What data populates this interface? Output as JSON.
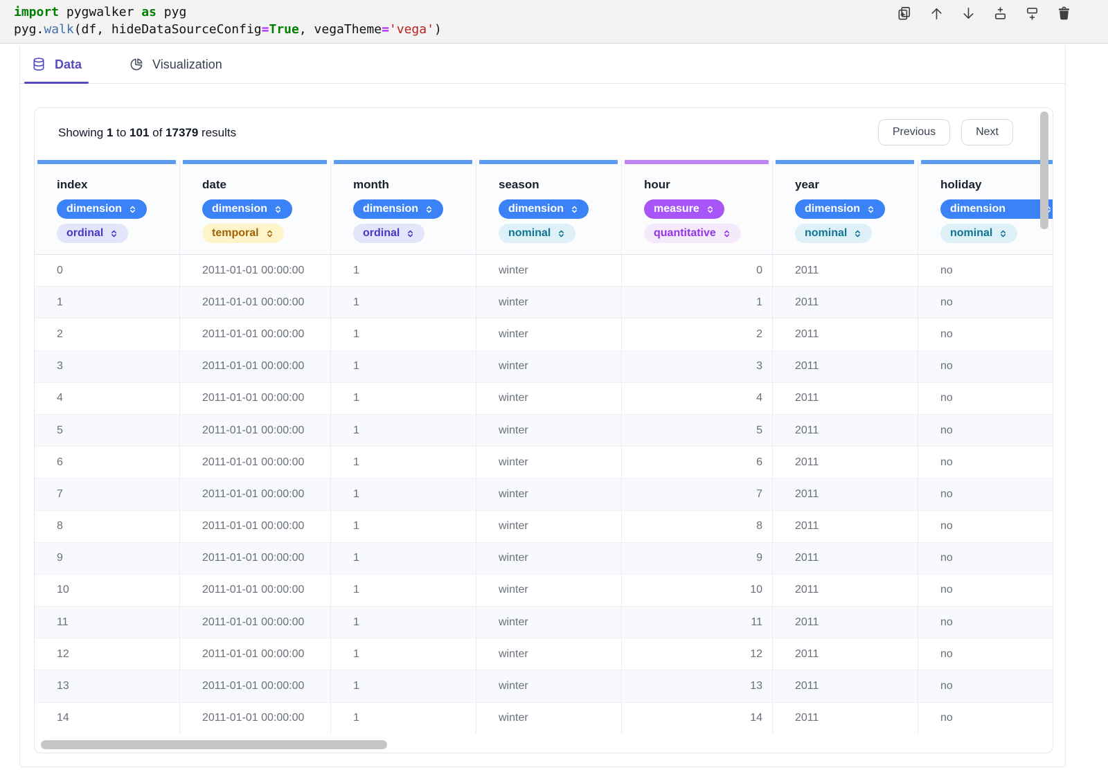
{
  "code_cell": {
    "lines": [
      {
        "tokens": [
          {
            "text": "import",
            "style": "keyword"
          },
          {
            "text": " pygwalker ",
            "style": "plain"
          },
          {
            "text": "as",
            "style": "keyword"
          },
          {
            "text": " pyg",
            "style": "plain"
          }
        ]
      },
      {
        "tokens": [
          {
            "text": "pyg.",
            "style": "plain"
          },
          {
            "text": "walk",
            "style": "function"
          },
          {
            "text": "(df, hideDataSourceConfig",
            "style": "plain"
          },
          {
            "text": "=",
            "style": "operator"
          },
          {
            "text": "True",
            "style": "keyword"
          },
          {
            "text": ", vegaTheme",
            "style": "plain"
          },
          {
            "text": "=",
            "style": "operator"
          },
          {
            "text": "'vega'",
            "style": "string"
          },
          {
            "text": ")",
            "style": "plain"
          }
        ]
      }
    ],
    "toolbar_icons": [
      "duplicate-cell-icon",
      "move-cell-up-icon",
      "move-cell-down-icon",
      "insert-cell-above-icon",
      "insert-cell-below-icon",
      "delete-cell-icon"
    ]
  },
  "tabs": [
    {
      "label": "Data",
      "icon": "database-icon",
      "active": true
    },
    {
      "label": "Visualization",
      "icon": "pie-chart-icon",
      "active": false
    }
  ],
  "results_bar": {
    "segments": [
      {
        "text": "Showing ",
        "bold": false
      },
      {
        "text": "1",
        "bold": true
      },
      {
        "text": " to ",
        "bold": false
      },
      {
        "text": "101",
        "bold": true
      },
      {
        "text": " of ",
        "bold": false
      },
      {
        "text": "17379",
        "bold": true
      },
      {
        "text": " results",
        "bold": false
      }
    ],
    "previous_label": "Previous",
    "next_label": "Next"
  },
  "table": {
    "columns": [
      {
        "name": "index",
        "role": "dimension",
        "type": "ordinal"
      },
      {
        "name": "date",
        "role": "dimension",
        "type": "temporal"
      },
      {
        "name": "month",
        "role": "dimension",
        "type": "ordinal"
      },
      {
        "name": "season",
        "role": "dimension",
        "type": "nominal"
      },
      {
        "name": "hour",
        "role": "measure",
        "type": "quantitative"
      },
      {
        "name": "year",
        "role": "dimension",
        "type": "nominal"
      },
      {
        "name": "holiday",
        "role": "dimension",
        "type": "nominal"
      }
    ],
    "rows": [
      [
        "0",
        "2011-01-01 00:00:00",
        "1",
        "winter",
        "0",
        "2011",
        "no"
      ],
      [
        "1",
        "2011-01-01 00:00:00",
        "1",
        "winter",
        "1",
        "2011",
        "no"
      ],
      [
        "2",
        "2011-01-01 00:00:00",
        "1",
        "winter",
        "2",
        "2011",
        "no"
      ],
      [
        "3",
        "2011-01-01 00:00:00",
        "1",
        "winter",
        "3",
        "2011",
        "no"
      ],
      [
        "4",
        "2011-01-01 00:00:00",
        "1",
        "winter",
        "4",
        "2011",
        "no"
      ],
      [
        "5",
        "2011-01-01 00:00:00",
        "1",
        "winter",
        "5",
        "2011",
        "no"
      ],
      [
        "6",
        "2011-01-01 00:00:00",
        "1",
        "winter",
        "6",
        "2011",
        "no"
      ],
      [
        "7",
        "2011-01-01 00:00:00",
        "1",
        "winter",
        "7",
        "2011",
        "no"
      ],
      [
        "8",
        "2011-01-01 00:00:00",
        "1",
        "winter",
        "8",
        "2011",
        "no"
      ],
      [
        "9",
        "2011-01-01 00:00:00",
        "1",
        "winter",
        "9",
        "2011",
        "no"
      ],
      [
        "10",
        "2011-01-01 00:00:00",
        "1",
        "winter",
        "10",
        "2011",
        "no"
      ],
      [
        "11",
        "2011-01-01 00:00:00",
        "1",
        "winter",
        "11",
        "2011",
        "no"
      ],
      [
        "12",
        "2011-01-01 00:00:00",
        "1",
        "winter",
        "12",
        "2011",
        "no"
      ],
      [
        "13",
        "2011-01-01 00:00:00",
        "1",
        "winter",
        "13",
        "2011",
        "no"
      ],
      [
        "14",
        "2011-01-01 00:00:00",
        "1",
        "winter",
        "14",
        "2011",
        "no"
      ]
    ]
  },
  "colors": {
    "tab_active": "#544bc3",
    "column_accent_dimension": "#5b9cf2",
    "column_accent_measure": "#bf83f5",
    "badge_dimension_bg": "#3b82f6",
    "badge_measure_bg": "#a855f7",
    "badge_ordinal": {
      "bg": "#e4e5fb",
      "fg": "#4338ca"
    },
    "badge_temporal": {
      "bg": "#fdf5c9",
      "fg": "#a16207"
    },
    "badge_nominal": {
      "bg": "#def0f8",
      "fg": "#0e7490"
    },
    "badge_quantitative": {
      "bg": "#f5eafc",
      "fg": "#9333ea"
    }
  }
}
